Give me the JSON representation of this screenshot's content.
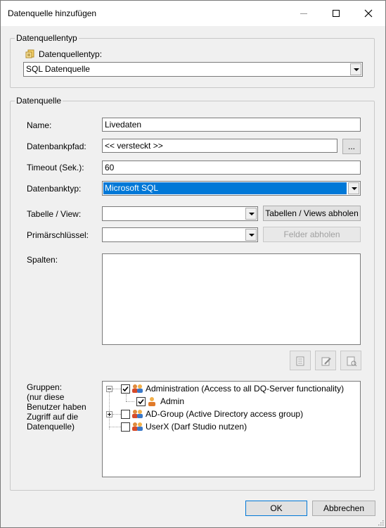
{
  "window": {
    "title": "Datenquelle hinzufügen"
  },
  "group_type": {
    "legend": "Datenquellentyp",
    "label": "Datenquellentyp:",
    "selected": "SQL Datenquelle"
  },
  "group_source": {
    "legend": "Datenquelle",
    "name_label": "Name:",
    "name_value": "Livedaten",
    "dbpath_label": "Datenbankpfad:",
    "dbpath_value": "<< versteckt >>",
    "browse_label": "...",
    "timeout_label": "Timeout (Sek.):",
    "timeout_value": "60",
    "dbtype_label": "Datenbanktyp:",
    "dbtype_value": "Microsoft SQL",
    "table_label": "Tabelle / View:",
    "table_value": "",
    "fetch_tables_label": "Tabellen / Views abholen",
    "pk_label": "Primärschlüssel:",
    "pk_value": "",
    "fetch_fields_label": "Felder abholen",
    "columns_label": "Spalten:",
    "groups_label_lines": [
      "Gruppen:",
      "(nur diese",
      "Benutzer haben",
      "Zugriff auf die",
      "Datenquelle)"
    ],
    "tree": [
      {
        "label": "Administration (Access to all DQ-Server functionality)",
        "checked": true,
        "expanded": true
      },
      {
        "label": "Admin",
        "checked": true
      },
      {
        "label": "AD-Group (Active Directory access group)",
        "checked": false,
        "expanded": false
      },
      {
        "label": "UserX (Darf Studio nutzen)",
        "checked": false
      }
    ]
  },
  "footer": {
    "ok_label": "OK",
    "cancel_label": "Abbrechen"
  },
  "colors": {
    "accent": "#0078d7",
    "window_bg": "#f0f0f0"
  }
}
